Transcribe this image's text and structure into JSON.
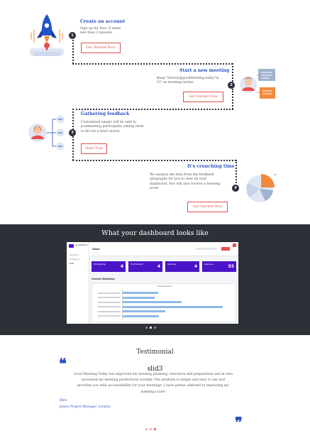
{
  "steps": [
    {
      "number": "1",
      "title": "Create an account",
      "text": [
        "Sign up for free. It takes",
        "less than 3 minutes"
      ],
      "cta": "Get Started Now",
      "illustration": "rocket-launch"
    },
    {
      "number": "2",
      "title": "Start a new meeting",
      "text": [
        "Keep \"Survey@goodMeeting.today\"in",
        "CC on meeting invites"
      ],
      "cta": "Get Started Now",
      "illustration": "user-with-documents"
    },
    {
      "number": "3",
      "title": "Gathering feedback",
      "text": [
        "Customised emails will be sent to",
        "postmeeting participants asking them",
        "to fill out a brief survey"
      ],
      "cta": "Start Trial",
      "illustration": "user-network"
    },
    {
      "number": "4",
      "title": "It's crunching time",
      "text": [
        "We analyse the data from the feedback",
        "infographs for you to view on your",
        "dashboard. You will also receive a meeting",
        "score"
      ],
      "cta": "Get Started Now",
      "illustration": "pie-chart"
    }
  ],
  "dashboard": {
    "heading": "What your dashboard looks like",
    "screenshot": {
      "logo": "goodMeeting",
      "page_title": "Stats",
      "sidebar_items": [
        "Dashboard",
        "My Meeting",
        "Stats"
      ],
      "cards": [
        {
          "label": "Total Meetings",
          "value": "4"
        },
        {
          "label": "Total Feedback",
          "value": "4"
        },
        {
          "label": "Attendees",
          "value": "4"
        },
        {
          "label": "Responses",
          "value": "55"
        }
      ],
      "chart_section_title": "Overall Statistics",
      "chart_title": "Overall Statistics",
      "bar_fractions": [
        0.33,
        0.3,
        0.55,
        0.94,
        0.4,
        0.34
      ],
      "card_color": "#4b14c8",
      "bar_color": "#8fb8e8"
    },
    "carousel_dots": 3,
    "active_dot": 1
  },
  "testimonial": {
    "heading": "Testimonial",
    "slide_label": "slid3",
    "body": [
      "Good Meeting Today has improved my meeting planning, execution and preparation and in turn",
      "increased my meeting productivity notably. The platform is simple and easy to use and",
      "provides you with accountability for your meetings. I have gotten addicted to improving my",
      "meeting score!"
    ],
    "author": "Mini",
    "role": "Junior Project Manager, London",
    "carousel_dots": 3,
    "active_dot": 2
  },
  "colors": {
    "accent_blue": "#2b4fc4",
    "cta_red": "#d9534f",
    "dark_band": "#2e3038",
    "dot_active": "#e0534f"
  }
}
